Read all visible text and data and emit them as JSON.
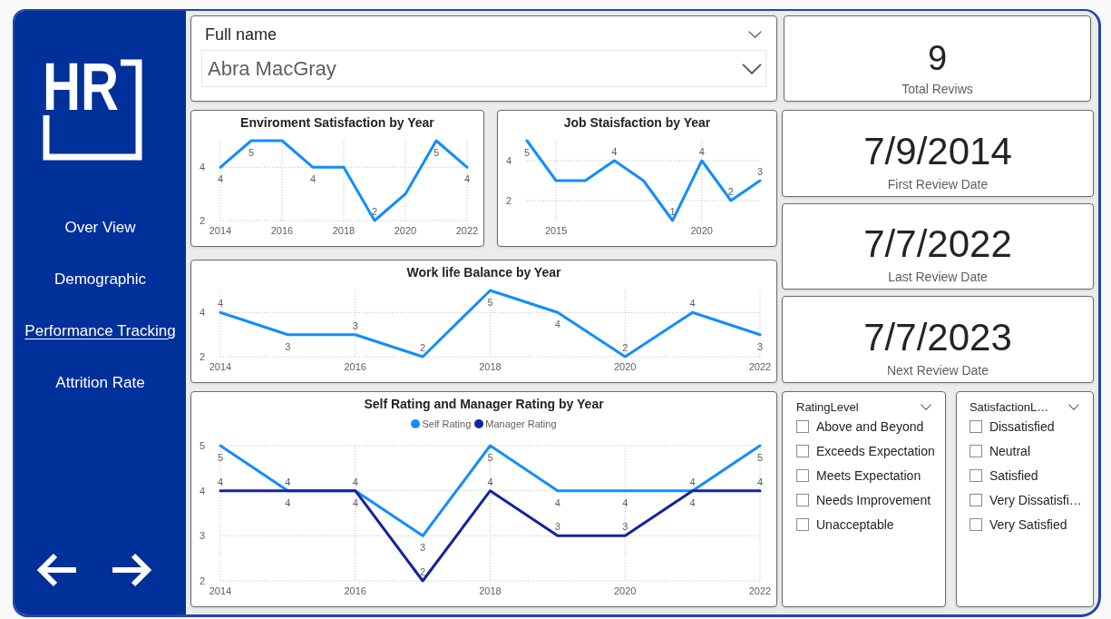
{
  "sidebar": {
    "logo": {
      "text": "HR"
    },
    "nav_items": [
      {
        "label": "Over View",
        "selected": false
      },
      {
        "label": "Demographic",
        "selected": false
      },
      {
        "label": "Performance Tracking",
        "selected": true
      },
      {
        "label": "Attrition Rate",
        "selected": false
      }
    ]
  },
  "name_slicer": {
    "title": "Full name",
    "value": "Abra MacGray"
  },
  "kpi_cards": [
    {
      "value": "9",
      "label": "Total Reviws"
    },
    {
      "value": "7/9/2014",
      "label": "First Review Date"
    },
    {
      "value": "7/7/2022",
      "label": "Last Review Date"
    },
    {
      "value": "7/7/2023",
      "label": "Next Review Date"
    }
  ],
  "charts": [
    {
      "chart_data": {
        "type": "line",
        "title": "Enviroment Satisfaction by Year",
        "x": [
          2014,
          2015,
          2016,
          2017,
          2018,
          2019,
          2020,
          2021,
          2022
        ],
        "series": [
          {
            "color": "#118dff",
            "values": [
              4,
              5,
              5,
              4,
              4,
              2,
              3,
              5,
              4
            ],
            "value_labels": [
              "4",
              "5",
              null,
              "4",
              null,
              "2",
              null,
              "5",
              "4"
            ]
          }
        ],
        "xlim": [
          2014,
          2022
        ],
        "ylim": [
          2,
          5
        ],
        "xticks": [
          2014,
          2016,
          2018,
          2020,
          2022
        ],
        "yticks": [
          2,
          4
        ],
        "grid": true
      }
    },
    {
      "chart_data": {
        "type": "line",
        "title": "Job Staisfaction by Year",
        "x": [
          2014,
          2015,
          2016,
          2017,
          2018,
          2019,
          2020,
          2021,
          2022
        ],
        "series": [
          {
            "color": "#118dff",
            "values": [
              5,
              3,
              3,
              4,
              3,
              1,
              4,
              2,
              3
            ],
            "value_labels": [
              "5",
              null,
              null,
              "4",
              null,
              "1",
              "4",
              "2",
              "3"
            ]
          }
        ],
        "xlim": [
          2014,
          2022
        ],
        "ylim": [
          1,
          5
        ],
        "xticks": [
          2015,
          2020
        ],
        "yticks": [
          2,
          4
        ],
        "grid": true
      }
    },
    {
      "chart_data": {
        "type": "line",
        "title": "Work life Balance by Year",
        "x": [
          2014,
          2015,
          2016,
          2017,
          2018,
          2019,
          2020,
          2021,
          2022
        ],
        "series": [
          {
            "color": "#118dff",
            "values": [
              4,
              3,
              3,
              2,
              5,
              4,
              2,
              4,
              3
            ]
          }
        ],
        "xlim": [
          2014,
          2022
        ],
        "ylim": [
          2,
          5
        ],
        "xticks": [
          2014,
          2016,
          2018,
          2020,
          2022
        ],
        "yticks": [
          2,
          4
        ],
        "grid": true,
        "data_labels": true
      }
    },
    {
      "chart_data": {
        "type": "line",
        "title": "Self Rating and Manager Rating by Year",
        "x": [
          2014,
          2015,
          2016,
          2017,
          2018,
          2019,
          2020,
          2021,
          2022
        ],
        "series": [
          {
            "name": "Self Rating",
            "color": "#118dff",
            "values": [
              5,
              4,
              4,
              3,
              5,
              4,
              4,
              4,
              5
            ]
          },
          {
            "name": "Manager Rating",
            "color": "#12239e",
            "values": [
              4,
              4,
              4,
              2,
              4,
              3,
              3,
              4,
              4
            ]
          }
        ],
        "xlim": [
          2014,
          2022
        ],
        "ylim": [
          2,
          5
        ],
        "xticks": [
          2014,
          2016,
          2018,
          2020,
          2022
        ],
        "yticks": [
          2,
          3,
          4,
          5
        ],
        "grid": true,
        "legend": true,
        "data_labels": true
      }
    }
  ],
  "slicers": [
    {
      "title": "RatingLevel",
      "items": [
        {
          "label": "Above and Beyond",
          "checked": false
        },
        {
          "label": "Exceeds Expectation",
          "checked": false
        },
        {
          "label": "Meets Expectation",
          "checked": false
        },
        {
          "label": "Needs Improvement",
          "checked": false
        },
        {
          "label": "Unacceptable",
          "checked": false
        }
      ]
    },
    {
      "title": "SatisfactionL…",
      "items": [
        {
          "label": "Dissatisfied",
          "checked": false
        },
        {
          "label": "Neutral",
          "checked": false
        },
        {
          "label": "Satisfied",
          "checked": false
        },
        {
          "label": "Very Dissatisfi…",
          "checked": false
        },
        {
          "label": "Very Satisfied",
          "checked": false
        }
      ]
    }
  ]
}
